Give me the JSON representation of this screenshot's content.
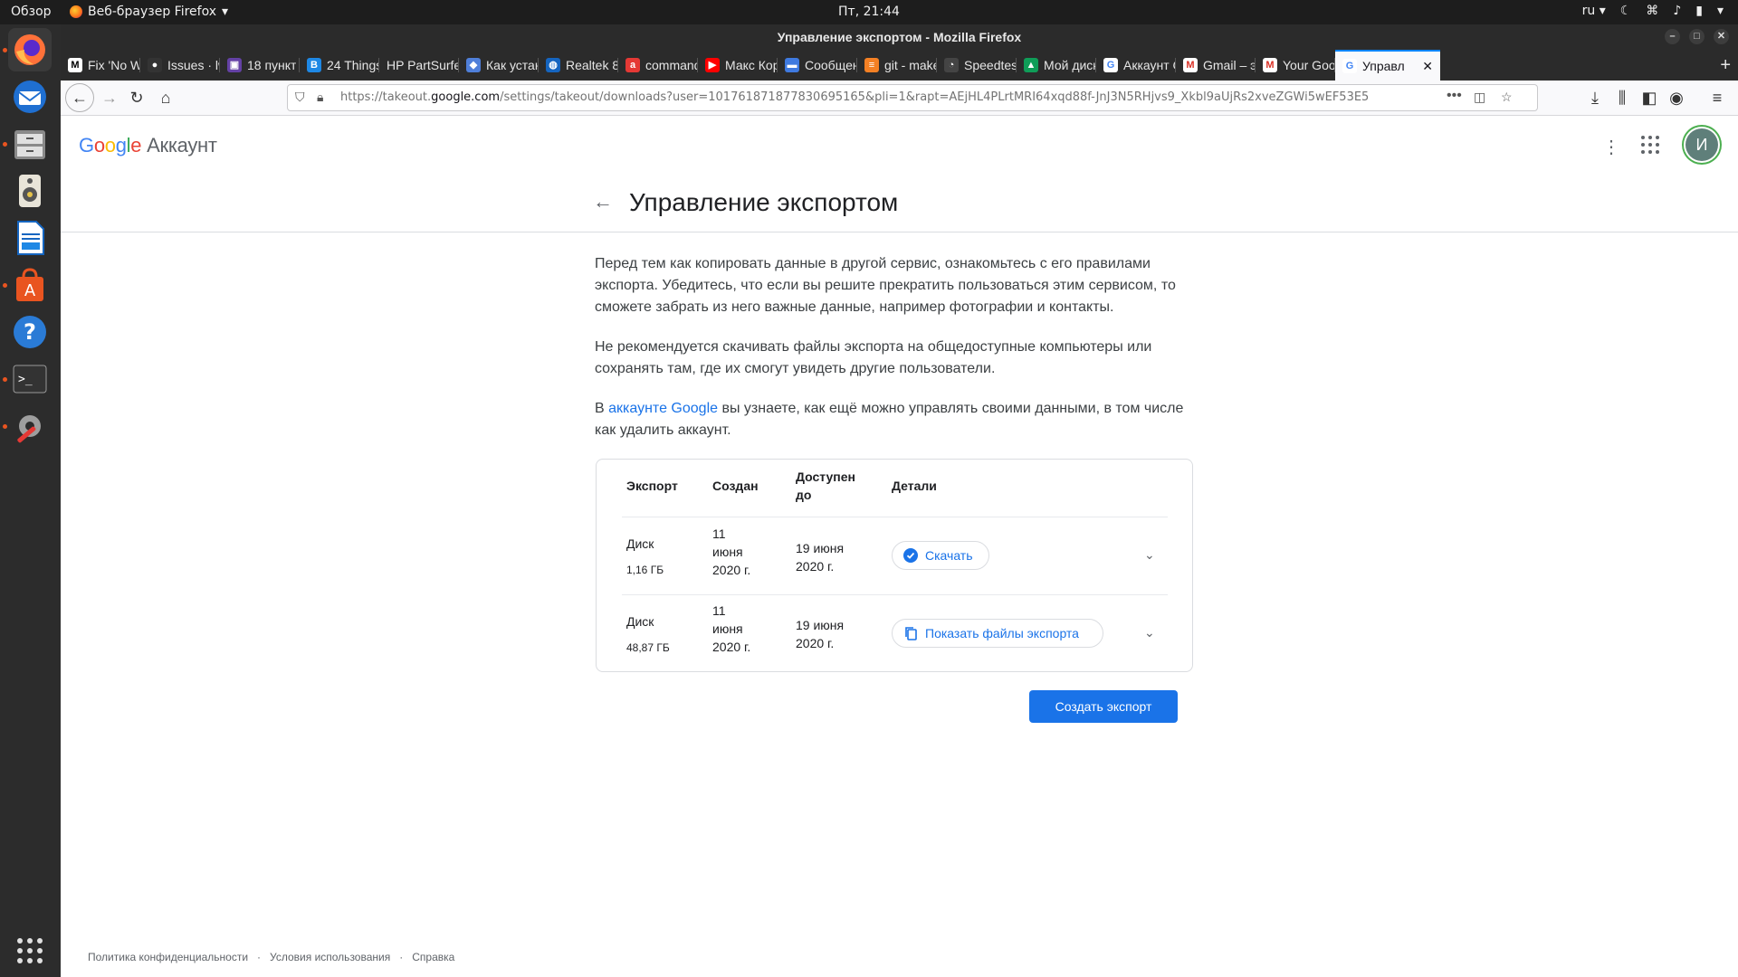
{
  "os": {
    "overview": "Обзор",
    "active_app": "Веб-браузер Firefox",
    "clock": "Пт, 21:44",
    "lang": "ru"
  },
  "window": {
    "title": "Управление экспортом - Mozilla Firefox"
  },
  "tabs": [
    {
      "label": "Fix 'No W",
      "favicon": "M",
      "color": "#000000"
    },
    {
      "label": "Issues · lw",
      "favicon": "github",
      "color": "#333333"
    },
    {
      "label": "18 пункт",
      "favicon": "twitch",
      "color": "#6441a5"
    },
    {
      "label": "24 Things",
      "favicon": "B",
      "color": "#1e88e5"
    },
    {
      "label": "HP PartSurfe",
      "favicon": "",
      "color": ""
    },
    {
      "label": "Как устан",
      "favicon": "pin",
      "color": "#4f7fd9"
    },
    {
      "label": "Realtek 8",
      "favicon": "globe",
      "color": "#1565c0"
    },
    {
      "label": "command",
      "favicon": "ask",
      "color": "#e53935"
    },
    {
      "label": "Макс Кор",
      "favicon": "youtube",
      "color": "#ff0000"
    },
    {
      "label": "Сообщен",
      "favicon": "chat",
      "color": "#3f7ae0"
    },
    {
      "label": "git - make",
      "favicon": "so",
      "color": "#f48024"
    },
    {
      "label": "Speedtes",
      "favicon": "speed",
      "color": "#444444"
    },
    {
      "label": "Мой диск",
      "favicon": "drive",
      "color": "#0f9d58"
    },
    {
      "label": "Аккаунт G",
      "favicon": "G",
      "color": "#4285f4"
    },
    {
      "label": "Gmail – эл",
      "favicon": "M",
      "color": "#d93025"
    },
    {
      "label": "Your Goo",
      "favicon": "M",
      "color": "#d93025"
    },
    {
      "label": "Управл",
      "favicon": "G",
      "color": "#4285f4"
    }
  ],
  "url": {
    "prefix": "https://takeout.",
    "domain": "google.com",
    "rest": "/settings/takeout/downloads?user=101761871877830695165&pli=1&rapt=AEjHL4PLrtMRI64xqd88f-JnJ3N5RHjvs9_Xkbl9aUjRs2xveZGWi5wEF53E5"
  },
  "header": {
    "logo_g1": "G",
    "logo_o1": "o",
    "logo_o2": "o",
    "logo_g2": "g",
    "logo_l": "l",
    "logo_e": "e",
    "product": "Аккаунт",
    "avatar_letter": "И"
  },
  "page": {
    "title": "Управление экспортом",
    "para1": "Перед тем как копировать данные в другой сервис, ознакомьтесь с его правилами экспорта. Убедитесь, что если вы решите прекратить пользоваться этим сервисом, то сможете забрать из него важные данные, например фотографии и контакты.",
    "para2": "Не рекомендуется скачивать файлы экспорта на общедоступные компьютеры или сохранять там, где их смогут увидеть другие пользователи.",
    "para3_before": "В ",
    "para3_link": "аккаунте Google",
    "para3_after": " вы узнаете, как ещё можно управлять своими данными, в том числе как удалить аккаунт."
  },
  "table": {
    "headers": {
      "export": "Экспорт",
      "created": "Создан",
      "available_1": "Доступен",
      "available_2": "до",
      "details": "Детали"
    },
    "rows": [
      {
        "name": "Диск",
        "size": "1,16 ГБ",
        "created_1": "11",
        "created_2": "июня",
        "created_3": "2020 г.",
        "avail_1": "19 июня",
        "avail_2": "2020 г.",
        "action": "Скачать"
      },
      {
        "name": "Диск",
        "size": "48,87 ГБ",
        "created_1": "11",
        "created_2": "июня",
        "created_3": "2020 г.",
        "avail_1": "19 июня",
        "avail_2": "2020 г.",
        "action": "Показать файлы экспорта"
      }
    ]
  },
  "create_button": "Создать экспорт",
  "footer": {
    "privacy": "Политика конфиденциальности",
    "terms": "Условия использования",
    "help": "Справка",
    "dot": "·"
  }
}
